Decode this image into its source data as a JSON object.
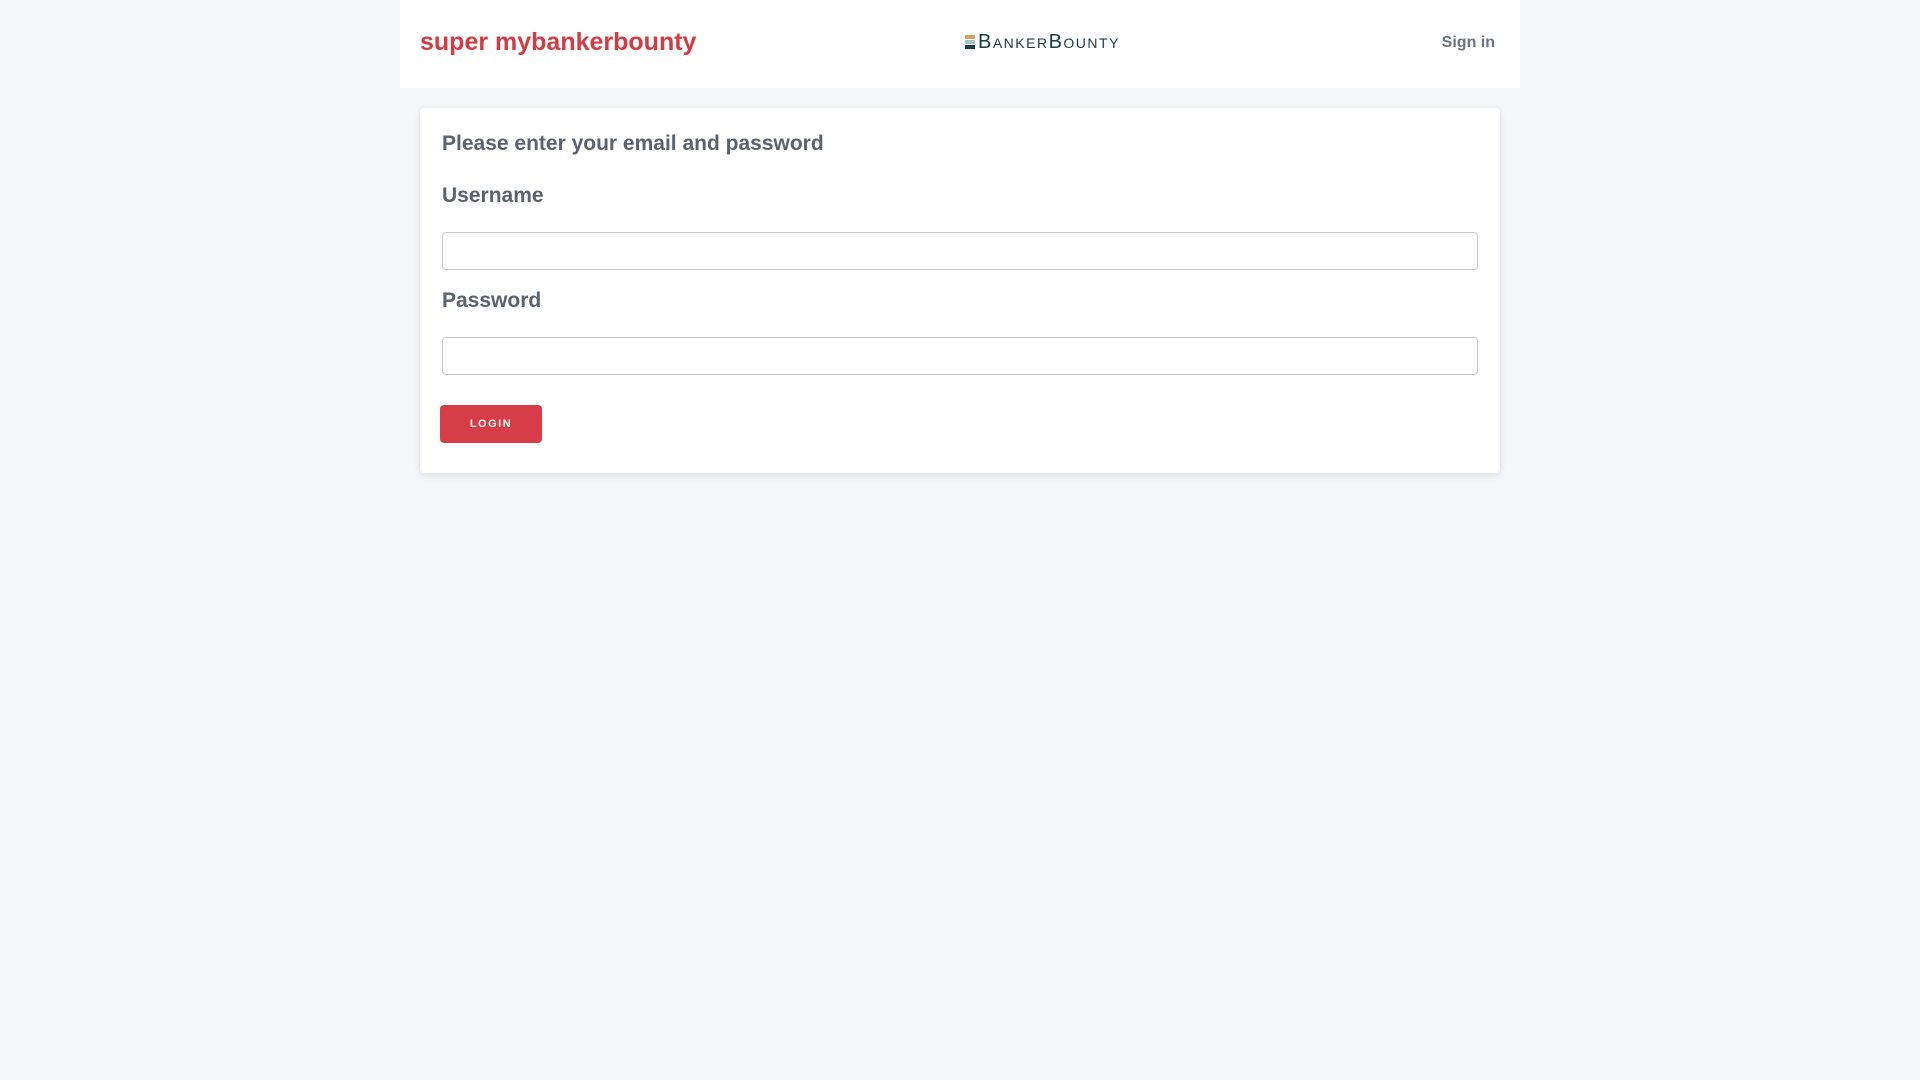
{
  "header": {
    "brand": "super mybankerbounty",
    "logo_text": "BankerBounty",
    "signin_label": "Sign in"
  },
  "form": {
    "heading": "Please enter your email and password",
    "username_label": "Username",
    "username_value": "",
    "password_label": "Password",
    "password_value": "",
    "login_label": "LOGIN"
  },
  "colors": {
    "accent": "#d63d47",
    "logo_orange": "#d9a066",
    "logo_teal": "#9fc5c8",
    "logo_dark": "#1d3a4a"
  }
}
